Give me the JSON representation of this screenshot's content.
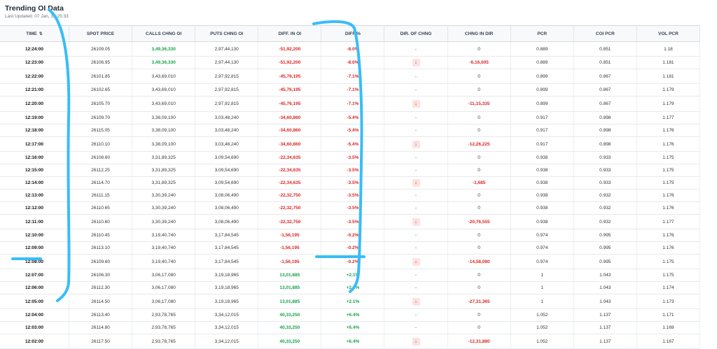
{
  "header": {
    "title": "Trending OI Data",
    "updated_label": "Last Updated:",
    "updated_value": "07 Jan, 12:25:33"
  },
  "columns": [
    "TIME",
    "SPOT PRICE",
    "CALLS CHNG OI",
    "PUTS CHNG OI",
    "DIFF. IN OI",
    "DIFF %",
    "DIR. OF CHNG",
    "CHNG IN DIR",
    "PCR",
    "COI PCR",
    "VOL PCR"
  ],
  "sort_icon": "⇅",
  "arrow_icon": "↓",
  "rows": [
    {
      "time": "12:24:00",
      "spot": "26109.05",
      "calls": "3,49,36,330",
      "puts": "2,97,44,130",
      "diff": "-51,92,200",
      "pct": "-8.0%",
      "dir": "-",
      "chng": "0",
      "pcr": "0.889",
      "coi": "0.851",
      "vol": "1.18",
      "call_green": true,
      "diff_pos": false,
      "arrow": false
    },
    {
      "time": "12:23:00",
      "spot": "26106.95",
      "calls": "3,49,36,330",
      "puts": "2,97,44,130",
      "diff": "-51,92,200",
      "pct": "-8.0%",
      "dir": "↓",
      "chng": "-6,16,005",
      "pcr": "0.889",
      "coi": "0.851",
      "vol": "1.181",
      "call_green": true,
      "diff_pos": false,
      "arrow": true
    },
    {
      "time": "12:22:00",
      "spot": "26101.85",
      "calls": "3,43,69,010",
      "puts": "2,97,92,815",
      "diff": "-45,76,195",
      "pct": "-7.1%",
      "dir": "-",
      "chng": "0",
      "pcr": "0.899",
      "coi": "0.867",
      "vol": "1.181",
      "call_green": false,
      "diff_pos": false,
      "arrow": false
    },
    {
      "time": "12:21:00",
      "spot": "26102.65",
      "calls": "3,43,69,010",
      "puts": "2,97,92,815",
      "diff": "-45,76,195",
      "pct": "-7.1%",
      "dir": "-",
      "chng": "0",
      "pcr": "0.899",
      "coi": "0.867",
      "vol": "1.179",
      "call_green": false,
      "diff_pos": false,
      "arrow": false
    },
    {
      "time": "12:20:00",
      "spot": "26105.70",
      "calls": "3,43,69,010",
      "puts": "2,97,92,815",
      "diff": "-45,76,195",
      "pct": "-7.1%",
      "dir": "↓",
      "chng": "-11,15,335",
      "pcr": "0.899",
      "coi": "0.867",
      "vol": "1.179",
      "call_green": false,
      "diff_pos": false,
      "arrow": true
    },
    {
      "time": "12:19:00",
      "spot": "26109.70",
      "calls": "3,38,09,100",
      "puts": "3,03,48,240",
      "diff": "-34,60,860",
      "pct": "-5.4%",
      "dir": "-",
      "chng": "0",
      "pcr": "0.917",
      "coi": "0.898",
      "vol": "1.177",
      "call_green": false,
      "diff_pos": false,
      "arrow": false
    },
    {
      "time": "12:18:00",
      "spot": "26115.05",
      "calls": "3,38,09,100",
      "puts": "3,03,48,240",
      "diff": "-34,60,860",
      "pct": "-5.4%",
      "dir": "-",
      "chng": "0",
      "pcr": "0.917",
      "coi": "0.898",
      "vol": "1.176",
      "call_green": false,
      "diff_pos": false,
      "arrow": false
    },
    {
      "time": "12:17:00",
      "spot": "26110.10",
      "calls": "3,38,09,100",
      "puts": "3,03,48,240",
      "diff": "-34,60,860",
      "pct": "-5.4%",
      "dir": "↓",
      "chng": "-12,26,225",
      "pcr": "0.917",
      "coi": "0.898",
      "vol": "1.176",
      "call_green": false,
      "diff_pos": false,
      "arrow": true
    },
    {
      "time": "12:16:00",
      "spot": "26108.60",
      "calls": "3,31,89,325",
      "puts": "3,09,54,690",
      "diff": "-22,34,635",
      "pct": "-3.5%",
      "dir": "-",
      "chng": "0",
      "pcr": "0.938",
      "coi": "0.933",
      "vol": "1.175",
      "call_green": false,
      "diff_pos": false,
      "arrow": false
    },
    {
      "time": "12:15:00",
      "spot": "26112.25",
      "calls": "3,31,89,325",
      "puts": "3,09,54,690",
      "diff": "-22,34,635",
      "pct": "-3.5%",
      "dir": "-",
      "chng": "0",
      "pcr": "0.938",
      "coi": "0.933",
      "vol": "1.175",
      "call_green": false,
      "diff_pos": false,
      "arrow": false
    },
    {
      "time": "12:14:00",
      "spot": "26114.70",
      "calls": "3,31,89,325",
      "puts": "3,09,54,690",
      "diff": "-22,34,635",
      "pct": "-3.5%",
      "dir": "↓",
      "chng": "-1,685",
      "pcr": "0.938",
      "coi": "0.933",
      "vol": "1.175",
      "call_green": false,
      "diff_pos": false,
      "arrow": true
    },
    {
      "time": "12:13:00",
      "spot": "26111.15",
      "calls": "3,30,39,240",
      "puts": "3,08,06,490",
      "diff": "-22,32,750",
      "pct": "-3.5%",
      "dir": "-",
      "chng": "0",
      "pcr": "0.938",
      "coi": "0.932",
      "vol": "1.176",
      "call_green": false,
      "diff_pos": false,
      "arrow": false
    },
    {
      "time": "12:12:00",
      "spot": "26110.65",
      "calls": "3,30,39,240",
      "puts": "3,08,06,490",
      "diff": "-22,32,750",
      "pct": "-3.5%",
      "dir": "-",
      "chng": "0",
      "pcr": "0.938",
      "coi": "0.932",
      "vol": "1.176",
      "call_green": false,
      "diff_pos": false,
      "arrow": false
    },
    {
      "time": "12:11:00",
      "spot": "26110.60",
      "calls": "3,30,39,240",
      "puts": "3,08,06,490",
      "diff": "-22,32,750",
      "pct": "-3.5%",
      "dir": "↓",
      "chng": "-20,76,555",
      "pcr": "0.938",
      "coi": "0.932",
      "vol": "1.177",
      "call_green": false,
      "diff_pos": false,
      "arrow": true
    },
    {
      "time": "12:10:00",
      "spot": "26110.45",
      "calls": "3,19,40,740",
      "puts": "3,17,84,545",
      "diff": "-1,56,195",
      "pct": "-0.2%",
      "dir": "-",
      "chng": "0",
      "pcr": "0.974",
      "coi": "0.995",
      "vol": "1.176",
      "call_green": false,
      "diff_pos": false,
      "arrow": false
    },
    {
      "time": "12:09:00",
      "spot": "26113.10",
      "calls": "3,19,40,740",
      "puts": "3,17,84,545",
      "diff": "-1,56,195",
      "pct": "-0.2%",
      "dir": "-",
      "chng": "0",
      "pcr": "0.974",
      "coi": "0.995",
      "vol": "1.176",
      "call_green": false,
      "diff_pos": false,
      "arrow": false
    },
    {
      "time": "12:08:00",
      "spot": "26109.60",
      "calls": "3,19,40,740",
      "puts": "3,17,84,545",
      "diff": "-1,56,195",
      "pct": "-0.2%",
      "dir": "↓",
      "chng": "-14,58,080",
      "pcr": "0.974",
      "coi": "0.995",
      "vol": "1.175",
      "call_green": false,
      "diff_pos": false,
      "arrow": true
    },
    {
      "time": "12:07:00",
      "spot": "26106.30",
      "calls": "3,06,17,080",
      "puts": "3,19,18,965",
      "diff": "13,01,885",
      "pct": "+2.1%",
      "dir": "-",
      "chng": "0",
      "pcr": "1",
      "coi": "1.043",
      "vol": "1.175",
      "call_green": false,
      "diff_pos": true,
      "arrow": false
    },
    {
      "time": "12:06:00",
      "spot": "26112.30",
      "calls": "3,06,17,080",
      "puts": "3,19,18,965",
      "diff": "13,01,885",
      "pct": "+2.1%",
      "dir": "-",
      "chng": "0",
      "pcr": "1",
      "coi": "1.043",
      "vol": "1.174",
      "call_green": false,
      "diff_pos": true,
      "arrow": false
    },
    {
      "time": "12:05:00",
      "spot": "26114.50",
      "calls": "3,06,17,080",
      "puts": "3,19,18,965",
      "diff": "13,01,885",
      "pct": "+2.1%",
      "dir": "↓",
      "chng": "-27,31,365",
      "pcr": "1",
      "coi": "1.043",
      "vol": "1.173",
      "call_green": false,
      "diff_pos": true,
      "arrow": true
    },
    {
      "time": "12:04:00",
      "spot": "26113.40",
      "calls": "2,93,78,765",
      "puts": "3,34,12,015",
      "diff": "40,33,250",
      "pct": "+6.4%",
      "dir": "-",
      "chng": "0",
      "pcr": "1.052",
      "coi": "1.137",
      "vol": "1.171",
      "call_green": false,
      "diff_pos": true,
      "arrow": false
    },
    {
      "time": "12:03:00",
      "spot": "26114.80",
      "calls": "2,93,78,765",
      "puts": "3,34,12,015",
      "diff": "40,33,250",
      "pct": "+6.4%",
      "dir": "-",
      "chng": "0",
      "pcr": "1.052",
      "coi": "1.137",
      "vol": "1.169",
      "call_green": false,
      "diff_pos": true,
      "arrow": false
    },
    {
      "time": "12:02:00",
      "spot": "26117.50",
      "calls": "2,93,78,765",
      "puts": "3,34,12,015",
      "diff": "40,33,250",
      "pct": "+6.4%",
      "dir": "↓",
      "chng": "-12,31,880",
      "pcr": "1.052",
      "coi": "1.137",
      "vol": "1.167",
      "call_green": false,
      "diff_pos": true,
      "arrow": true
    }
  ],
  "colors": {
    "green": "#16a34a",
    "red": "#dc2626",
    "annotation": "#38bdf8"
  }
}
